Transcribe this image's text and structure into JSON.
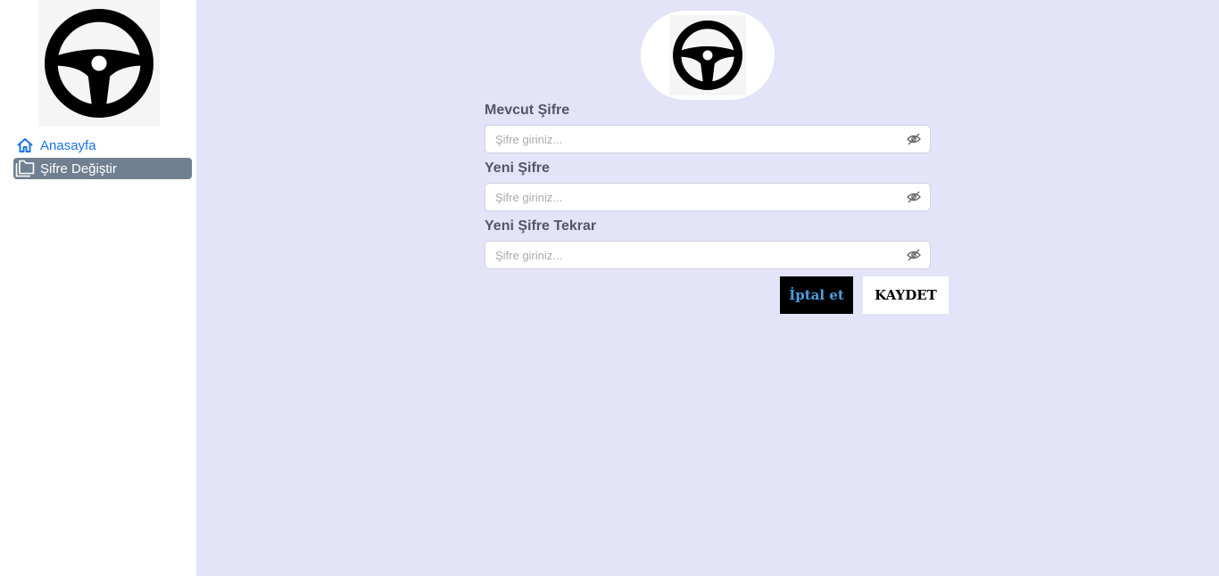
{
  "sidebar": {
    "logo_icon": "steering-wheel-icon",
    "items": [
      {
        "label": "Anasayfa",
        "icon": "home-icon",
        "color": "#1a73e8"
      },
      {
        "label": "Şifre Değiştir",
        "icon": "folders-icon",
        "active": true,
        "bg": "#708090"
      }
    ]
  },
  "main": {
    "logo_icon": "steering-wheel-icon",
    "background": "#e4e4f8",
    "fields": [
      {
        "label": "Mevcut Şifre",
        "placeholder": "Şifre giriniz...",
        "value": ""
      },
      {
        "label": "Yeni Şifre",
        "placeholder": "Şifre giriniz...",
        "value": ""
      },
      {
        "label": "Yeni Şifre Tekrar",
        "placeholder": "Şifre giriniz...",
        "value": ""
      }
    ],
    "buttons": {
      "cancel": "İptal et",
      "save": "KAYDET"
    }
  }
}
